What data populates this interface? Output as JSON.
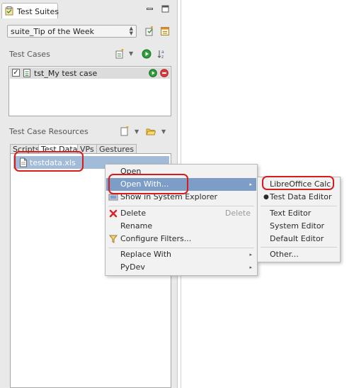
{
  "view": {
    "title": "Test Suites"
  },
  "suite_select": {
    "value": "suite_Tip of the Week"
  },
  "test_cases": {
    "title": "Test Cases",
    "rows": [
      {
        "label": "tst_My test case",
        "checked": true
      }
    ]
  },
  "resources": {
    "title": "Test Case Resources",
    "tabs": [
      "Scripts",
      "Test Data",
      "VPs",
      "Gestures"
    ],
    "active_tab": "Test Data",
    "files": [
      {
        "label": "testdata.xls"
      }
    ]
  },
  "context_menu": {
    "items": {
      "open": "Open",
      "open_with": "Open With...",
      "show_in_explorer": "Show in System Explorer",
      "delete": "Delete",
      "delete_shortcut": "Delete",
      "rename": "Rename",
      "configure_filters": "Configure Filters...",
      "replace_with": "Replace With",
      "pydev": "PyDev"
    }
  },
  "open_with_menu": {
    "items": {
      "libreoffice": "LibreOffice Calc",
      "test_data_editor": "Test Data Editor",
      "text_editor": "Text Editor",
      "system_editor": "System Editor",
      "default_editor": "Default Editor",
      "other": "Other..."
    }
  },
  "colors": {
    "highlight": "#7d9dc6",
    "selected_row": "#a1bbd8",
    "annotation": "#d81b1b",
    "run_green": "#2e9d3a",
    "stop_red": "#e03a3a"
  }
}
